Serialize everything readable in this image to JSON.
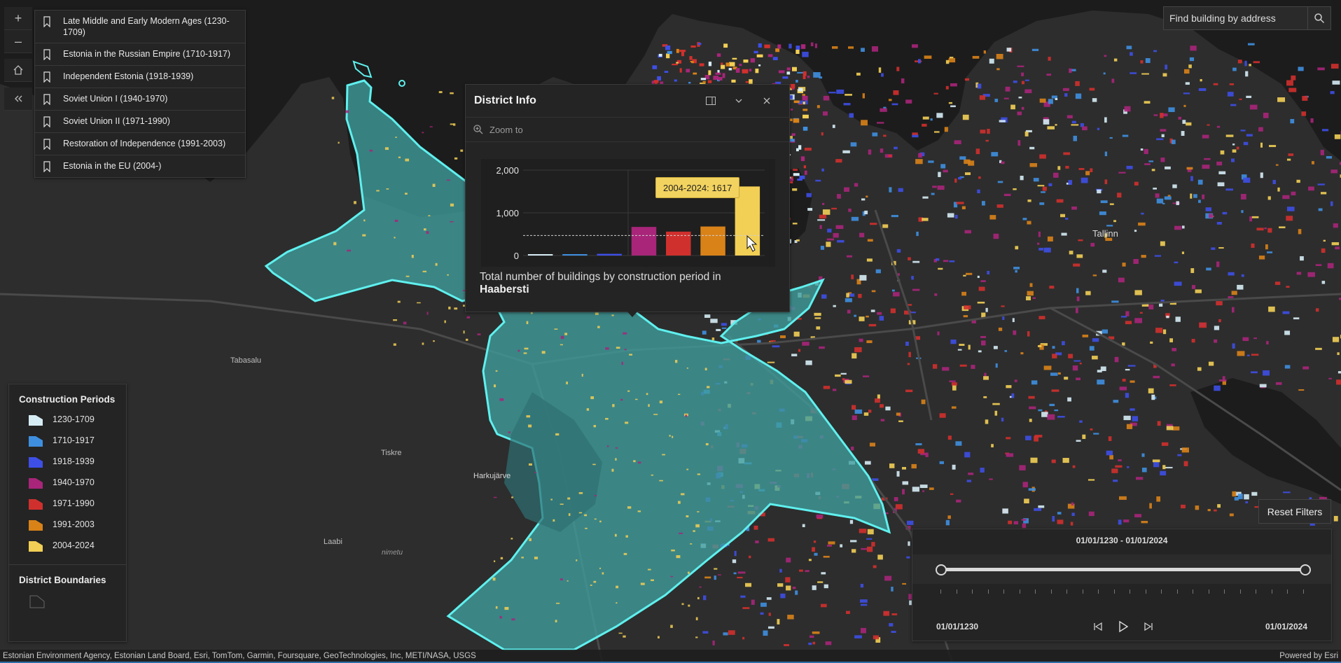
{
  "map": {
    "zoom_in_label": "+",
    "zoom_out_label": "–",
    "place_labels": [
      "Tallinn",
      "Tabasalu",
      "Tiskre",
      "Harkujärve",
      "Laabi",
      "nimetu"
    ],
    "colors": {
      "water": "#1b1b1b",
      "land": "#2d2d2d",
      "district_fill": "#3f9e9e",
      "district_stroke": "#5ff0ee"
    }
  },
  "bookmarks": [
    {
      "icon": "bookmark-icon",
      "label": "Late Middle and Early Modern Ages (1230-1709)"
    },
    {
      "icon": "bookmark-icon",
      "label": "Estonia in the Russian Empire (1710-1917)"
    },
    {
      "icon": "bookmark-icon",
      "label": "Independent Estonia (1918-1939)"
    },
    {
      "icon": "bookmark-icon",
      "label": "Soviet Union I (1940-1970)"
    },
    {
      "icon": "bookmark-icon",
      "label": "Soviet Union II (1971-1990)"
    },
    {
      "icon": "bookmark-icon",
      "label": "Restoration of Independence (1991-2003)"
    },
    {
      "icon": "bookmark-icon",
      "label": "Estonia in the EU (2004-)"
    }
  ],
  "search": {
    "placeholder": "Find building by address"
  },
  "popup": {
    "title": "District Info",
    "zoom_to_label": "Zoom to",
    "caption_prefix": "Total number of buildings by construction period in",
    "district_name": "Haabersti",
    "tooltip": "2004-2024: 1617"
  },
  "chart_data": {
    "type": "bar",
    "categories": [
      "1230-1709",
      "1710-1917",
      "1918-1939",
      "1940-1970",
      "1971-1990",
      "1991-2003",
      "2004-2024"
    ],
    "values": [
      5,
      15,
      40,
      670,
      560,
      680,
      1617
    ],
    "colors": [
      "#d6ecf5",
      "#3f8fe0",
      "#3e4fe6",
      "#a8257a",
      "#d0302d",
      "#d98218",
      "#f2cf55"
    ],
    "ylim": [
      0,
      2000
    ],
    "yticks": [
      "2,000",
      "1,000",
      "0"
    ],
    "title": "",
    "xlabel": "",
    "ylabel": "",
    "grid": true
  },
  "legend": {
    "title": "Construction Periods",
    "items": [
      {
        "label": "1230-1709",
        "color": "#d6ecf5"
      },
      {
        "label": "1710-1917",
        "color": "#3f8fe0"
      },
      {
        "label": "1918-1939",
        "color": "#3e4fe6"
      },
      {
        "label": "1940-1970",
        "color": "#a8257a"
      },
      {
        "label": "1971-1990",
        "color": "#d0302d"
      },
      {
        "label": "1991-2003",
        "color": "#d98218"
      },
      {
        "label": "2004-2024",
        "color": "#f2cf55"
      }
    ],
    "boundaries_title": "District Boundaries"
  },
  "time_slider": {
    "reset_label": "Reset Filters",
    "range_label": "01/01/1230  -  01/01/2024",
    "min_label": "01/01/1230",
    "max_label": "01/01/2024"
  },
  "attribution": {
    "sources": "Estonian Environment Agency, Estonian Land Board, Esri, TomTom, Garmin, Foursquare, GeoTechnologies, Inc, METI/NASA, USGS",
    "powered_by": "Powered by Esri"
  }
}
